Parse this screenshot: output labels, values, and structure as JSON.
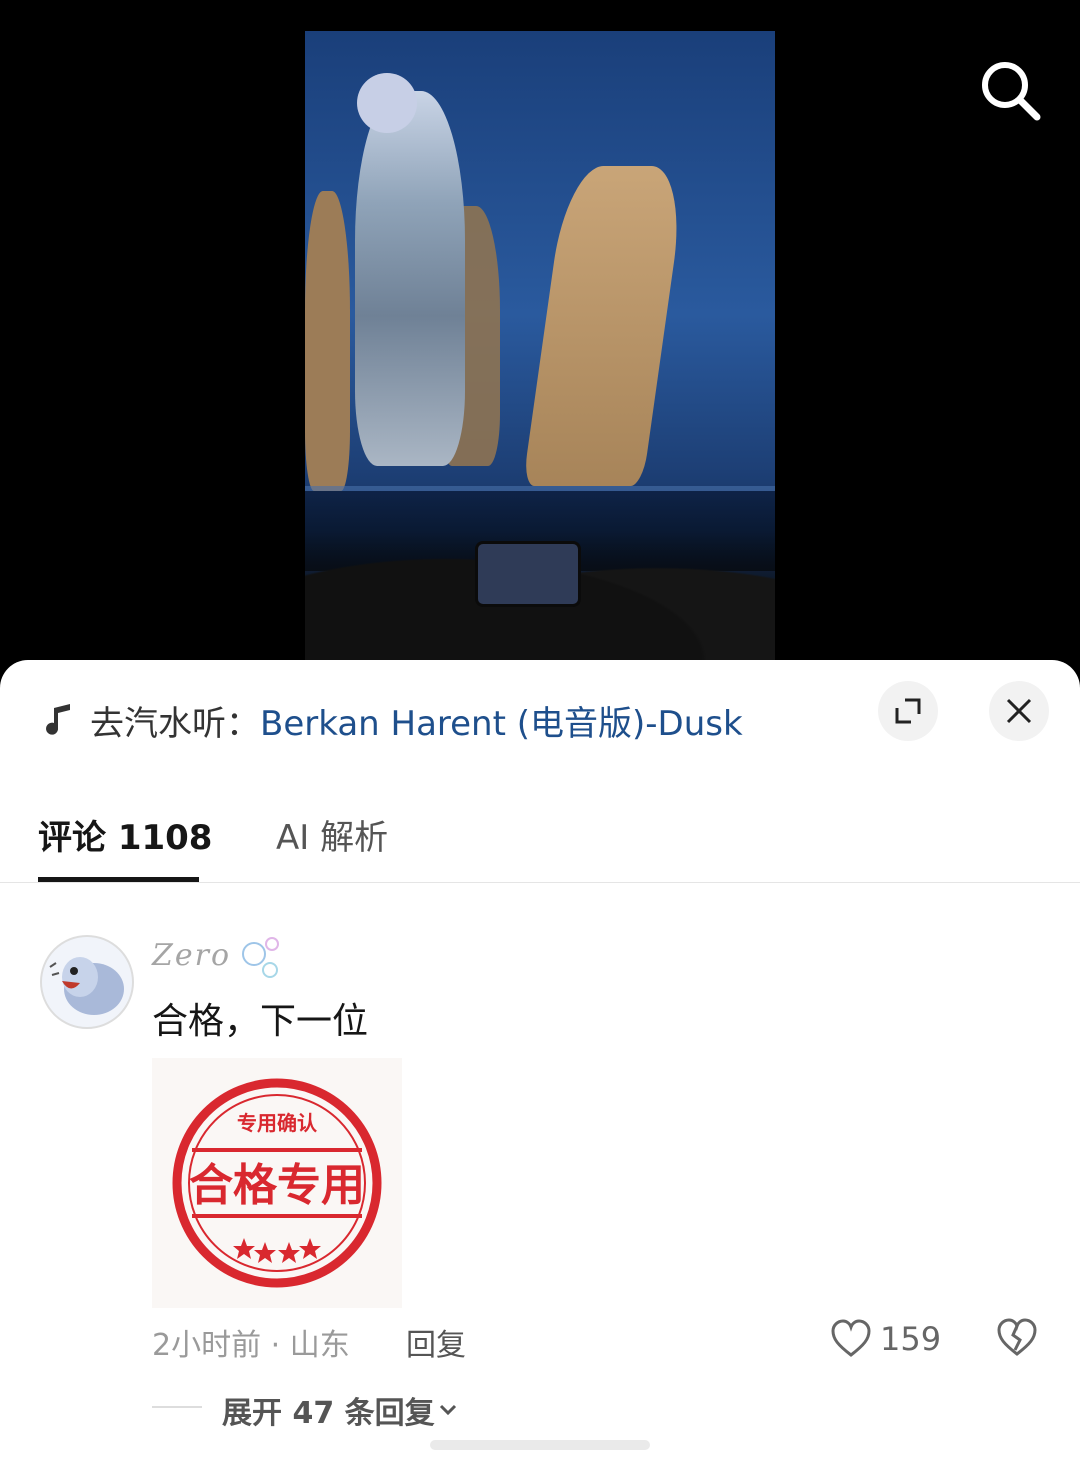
{
  "video": {
    "search_icon": "search-icon"
  },
  "music": {
    "icon": "music-note-icon",
    "prefix": "去汽水听：",
    "song": "Berkan Harent (电音版)-Dusk"
  },
  "tabs": [
    {
      "label": "评论 1108",
      "active": true
    },
    {
      "label": "AI 解析",
      "active": false
    }
  ],
  "comment": {
    "username": "Zero",
    "text": "合格，下一位",
    "sticker": {
      "ring_text": "专用确认",
      "center_text": "合格专用",
      "color": "#d9282f"
    },
    "meta": "2小时前 · 山东",
    "reply_label": "回复",
    "likes": "159",
    "expand_label": "展开 47 条回复"
  },
  "colors": {
    "song_link": "#1e4f8c",
    "stamp_red": "#d9282f"
  }
}
